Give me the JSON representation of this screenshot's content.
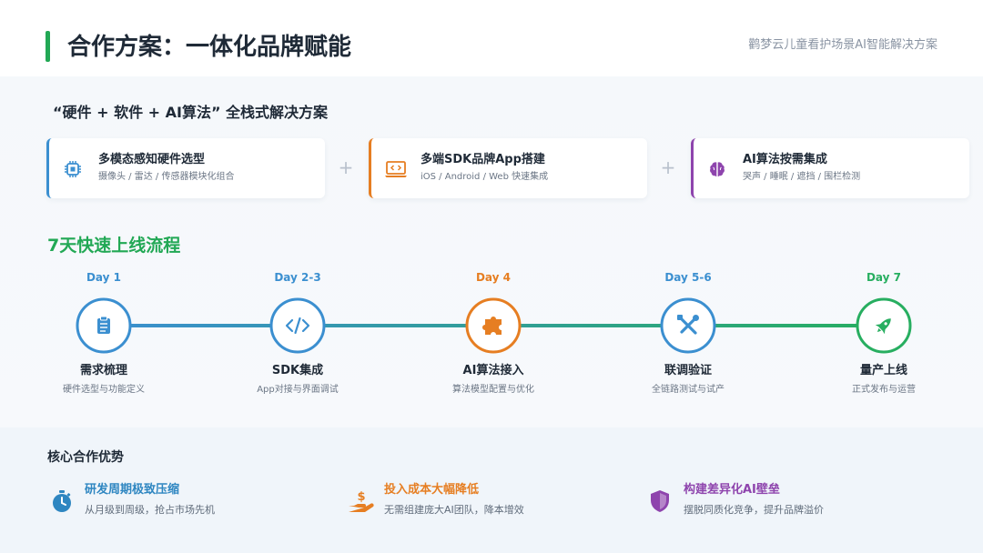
{
  "header": {
    "title": "合作方案：一体化品牌赋能",
    "subtitle": "鹳梦云儿童看护场景AI智能解决方案"
  },
  "solution": {
    "title": "“硬件 + 软件 + AI算法” 全栈式解决方案",
    "plus_symbol": "+",
    "cards": [
      {
        "title": "多模态感知硬件选型",
        "subtitle": "摄像头 / 雷达 / 传感器模块化组合",
        "icon": "chip-icon",
        "color": "#3b8fd0"
      },
      {
        "title": "多端SDK品牌App搭建",
        "subtitle": "iOS / Android / Web 快速集成",
        "icon": "laptop-code-icon",
        "color": "#e67e22"
      },
      {
        "title": "AI算法按需集成",
        "subtitle": "哭声 / 睡眠 / 遮挡 / 围栏检测",
        "icon": "brain-icon",
        "color": "#8e44ad"
      }
    ]
  },
  "process": {
    "title": "7天快速上线流程",
    "line_color": "#27ae60",
    "steps": [
      {
        "day": "Day 1",
        "name": "需求梳理",
        "desc": "硬件选型与功能定义",
        "icon": "clipboard-icon",
        "color": "#3b8fd0"
      },
      {
        "day": "Day 2-3",
        "name": "SDK集成",
        "desc": "App对接与界面调试",
        "icon": "code-icon",
        "color": "#3b8fd0"
      },
      {
        "day": "Day 4",
        "name": "AI算法接入",
        "desc": "算法模型配置与优化",
        "icon": "puzzle-icon",
        "color": "#e67e22"
      },
      {
        "day": "Day 5-6",
        "name": "联调验证",
        "desc": "全链路测试与试产",
        "icon": "tools-icon",
        "color": "#3b8fd0"
      },
      {
        "day": "Day 7",
        "name": "量产上线",
        "desc": "正式发布与运营",
        "icon": "rocket-icon",
        "color": "#27ae60"
      }
    ]
  },
  "advantages": {
    "title": "核心合作优势",
    "items": [
      {
        "title": "研发周期极致压缩",
        "desc": "从月级到周级，抢占市场先机",
        "icon": "stopwatch-icon",
        "color": "#2e86c1"
      },
      {
        "title": "投入成本大幅降低",
        "desc": "无需组建庞大AI团队，降本增效",
        "icon": "hand-coin-icon",
        "color": "#e67e22"
      },
      {
        "title": "构建差异化AI壁垒",
        "desc": "摆脱同质化竞争，提升品牌溢价",
        "icon": "shield-icon",
        "color": "#8e44ad"
      }
    ]
  }
}
